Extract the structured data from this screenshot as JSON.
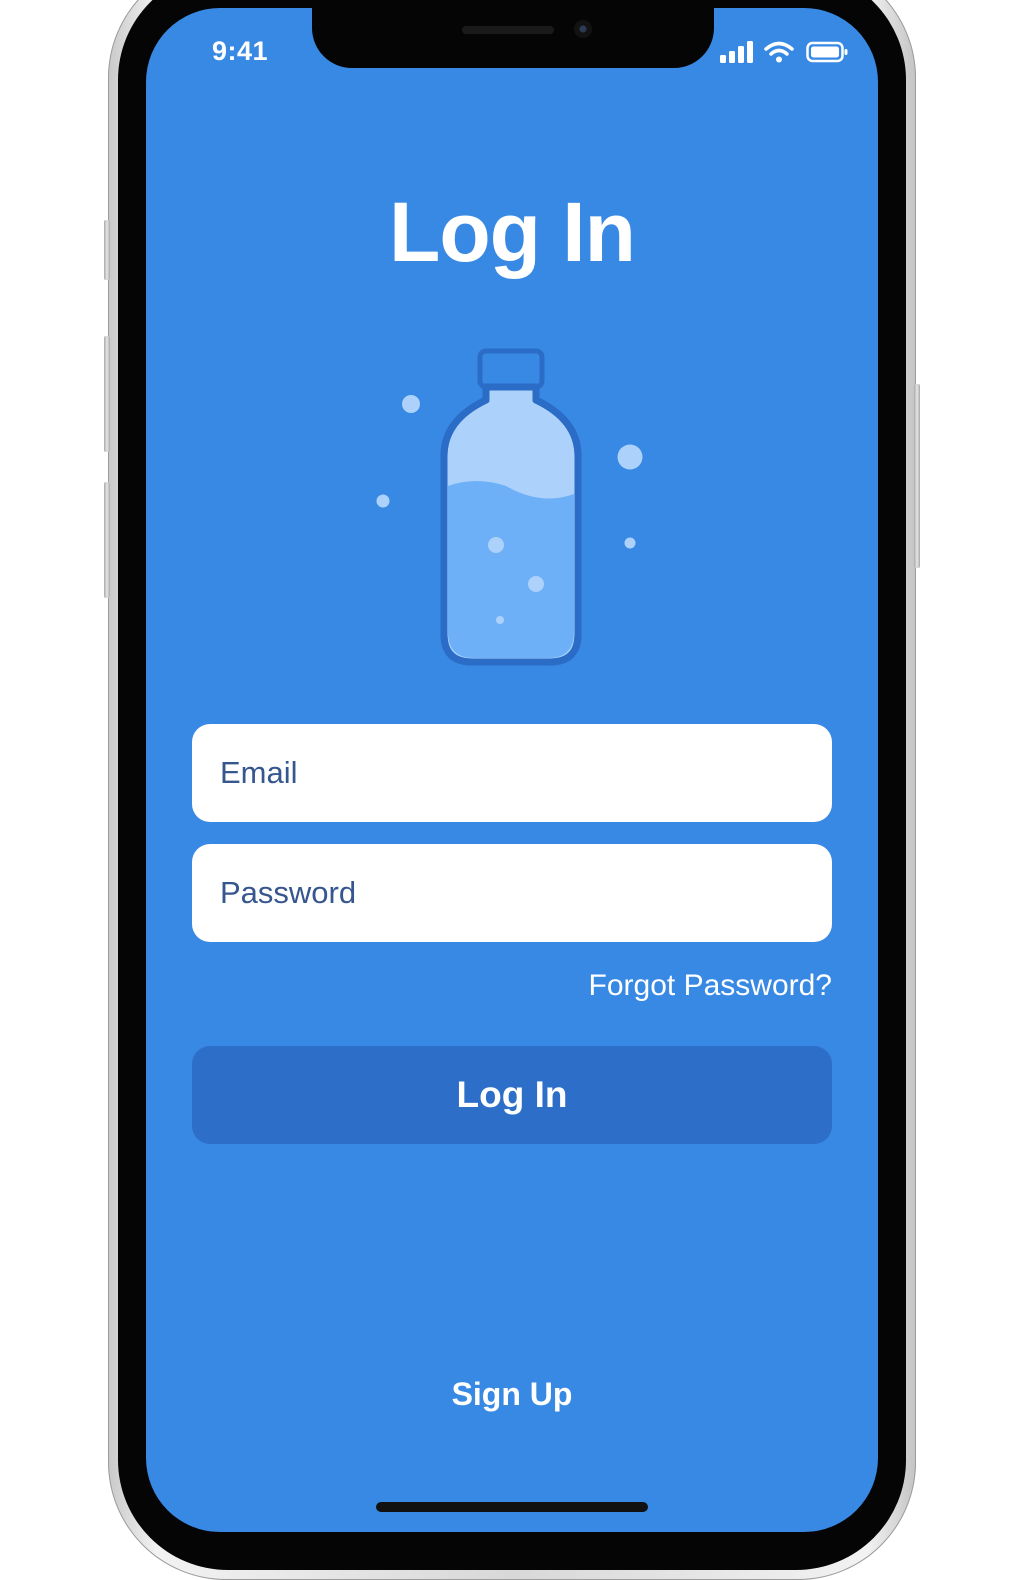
{
  "status_bar": {
    "time": "9:41",
    "icons": [
      "cellular-signal-icon",
      "wifi-icon",
      "battery-icon"
    ]
  },
  "screen": {
    "title": "Log In",
    "illustration": "water-bottle-icon"
  },
  "form": {
    "email_placeholder": "Email",
    "password_placeholder": "Password",
    "forgot_label": "Forgot Password?",
    "login_label": "Log In"
  },
  "footer": {
    "signup_label": "Sign Up"
  },
  "colors": {
    "background": "#3889e4",
    "button": "#2d6fc8",
    "field": "#ffffff",
    "field_text": "#36568f",
    "bottle_outline": "#2a6cc6",
    "water_light": "#acd2fb",
    "water": "#6eb0f8"
  }
}
